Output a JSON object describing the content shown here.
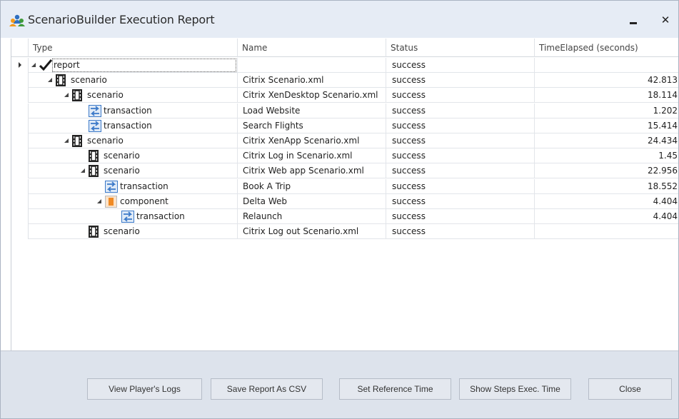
{
  "window": {
    "title": "ScenarioBuilder Execution Report",
    "minimize_icon": "minimize-icon",
    "close_icon": "close-icon",
    "close_glyph": "✕"
  },
  "grid": {
    "columns": [
      "Type",
      "Name",
      "Status",
      "TimeElapsed (seconds)"
    ],
    "rows": [
      {
        "type": "report",
        "name": "",
        "status": "success",
        "time": "",
        "level": 0,
        "icon": "checkmark-icon",
        "expanded": true
      },
      {
        "type": "scenario",
        "name": "Citrix Scenario.xml",
        "status": "success",
        "time": "42.813",
        "level": 1,
        "icon": "film-icon",
        "expanded": true
      },
      {
        "type": "scenario",
        "name": "Citrix XenDesktop Scenario.xml",
        "status": "success",
        "time": "18.114",
        "level": 2,
        "icon": "film-icon",
        "expanded": true
      },
      {
        "type": "transaction",
        "name": "Load Website",
        "status": "success",
        "time": "1.202",
        "level": 3,
        "icon": "transaction-icon",
        "expanded": false
      },
      {
        "type": "transaction",
        "name": "Search Flights",
        "status": "success",
        "time": "15.414",
        "level": 3,
        "icon": "transaction-icon",
        "expanded": false
      },
      {
        "type": "scenario",
        "name": "Citrix XenApp Scenario.xml",
        "status": "success",
        "time": "24.434",
        "level": 2,
        "icon": "film-icon",
        "expanded": true
      },
      {
        "type": "scenario",
        "name": "Citrix Log in Scenario.xml",
        "status": "success",
        "time": "1.45",
        "level": 3,
        "icon": "film-icon",
        "expanded": false
      },
      {
        "type": "scenario",
        "name": "Citrix Web app Scenario.xml",
        "status": "success",
        "time": "22.956",
        "level": 3,
        "icon": "film-icon",
        "expanded": true
      },
      {
        "type": "transaction",
        "name": "Book A Trip",
        "status": "success",
        "time": "18.552",
        "level": 4,
        "icon": "transaction-icon",
        "expanded": false
      },
      {
        "type": "component",
        "name": "Delta Web",
        "status": "success",
        "time": "4.404",
        "level": 4,
        "icon": "component-icon",
        "expanded": true
      },
      {
        "type": "transaction",
        "name": "Relaunch",
        "status": "success",
        "time": "4.404",
        "level": 5,
        "icon": "transaction-icon",
        "expanded": false
      },
      {
        "type": "scenario",
        "name": "Citrix Log out Scenario.xml",
        "status": "success",
        "time": "",
        "level": 3,
        "icon": "film-icon",
        "expanded": false
      }
    ]
  },
  "buttons": {
    "view_logs": "View Player's Logs",
    "save_csv": "Save Report As CSV",
    "set_reference": "Set Reference Time",
    "show_steps": "Show Steps Exec. Time",
    "close": "Close"
  },
  "colors": {
    "titlebar": "#e6ecf5",
    "footer": "#dde3ec",
    "transaction_icon": "#3a78c8",
    "component_icon": "#f08a24"
  }
}
